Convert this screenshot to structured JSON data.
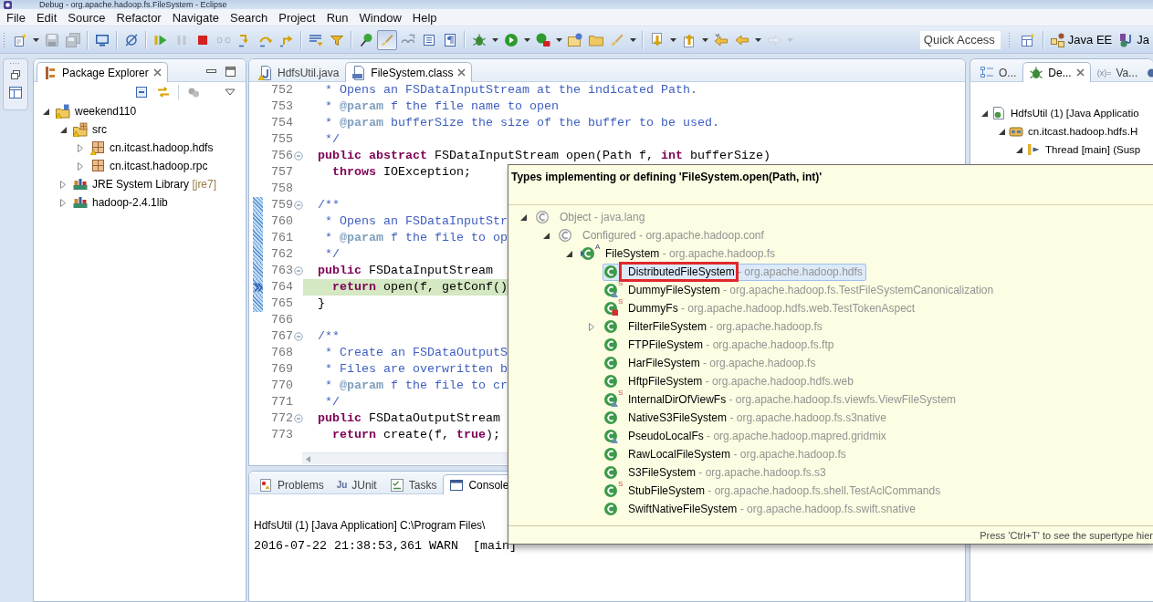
{
  "window": {
    "title": "Debug - org.apache.hadoop.fs.FileSystem - Eclipse"
  },
  "menu": [
    "File",
    "Edit",
    "Source",
    "Refactor",
    "Navigate",
    "Search",
    "Project",
    "Run",
    "Window",
    "Help"
  ],
  "toolbar": {
    "items": [
      {
        "kind": "new",
        "dropdown": true,
        "disabled": false,
        "pressed": false
      },
      {
        "kind": "save",
        "dropdown": false,
        "disabled": true,
        "pressed": false
      },
      {
        "kind": "save-all",
        "dropdown": false,
        "disabled": true,
        "pressed": false
      },
      {
        "kind": "separator"
      },
      {
        "kind": "monitor",
        "dropdown": false,
        "disabled": false,
        "pressed": false
      },
      {
        "kind": "separator"
      },
      {
        "kind": "skip-breakpoints",
        "dropdown": false,
        "disabled": false,
        "pressed": false
      },
      {
        "kind": "separator"
      },
      {
        "kind": "resume",
        "dropdown": false,
        "disabled": false,
        "pressed": false
      },
      {
        "kind": "suspend",
        "dropdown": false,
        "disabled": true,
        "pressed": false
      },
      {
        "kind": "terminate",
        "dropdown": false,
        "disabled": false,
        "pressed": false
      },
      {
        "kind": "disconnect",
        "dropdown": false,
        "disabled": true,
        "pressed": false
      },
      {
        "kind": "step-into",
        "dropdown": false,
        "disabled": false,
        "pressed": false
      },
      {
        "kind": "step-over",
        "dropdown": false,
        "disabled": false,
        "pressed": false
      },
      {
        "kind": "step-return",
        "dropdown": false,
        "disabled": false,
        "pressed": false
      },
      {
        "kind": "separator"
      },
      {
        "kind": "drop-frame",
        "dropdown": false,
        "disabled": false,
        "pressed": false
      },
      {
        "kind": "step-filters",
        "dropdown": false,
        "disabled": false,
        "pressed": false
      },
      {
        "kind": "separator"
      },
      {
        "kind": "breakpoint-pin",
        "dropdown": false,
        "disabled": false,
        "pressed": false
      },
      {
        "kind": "highlight",
        "dropdown": false,
        "disabled": false,
        "pressed": true
      },
      {
        "kind": "show-whitespace",
        "dropdown": false,
        "disabled": false,
        "pressed": false
      },
      {
        "kind": "block-select",
        "dropdown": false,
        "disabled": false,
        "pressed": false
      },
      {
        "kind": "paragraph",
        "dropdown": false,
        "disabled": false,
        "pressed": false
      },
      {
        "kind": "separator"
      },
      {
        "kind": "debug",
        "dropdown": true,
        "disabled": false,
        "pressed": false
      },
      {
        "kind": "run",
        "dropdown": true,
        "disabled": false,
        "pressed": false
      },
      {
        "kind": "external-tools",
        "dropdown": true,
        "disabled": false,
        "pressed": false
      },
      {
        "kind": "new-package",
        "dropdown": false,
        "disabled": false,
        "pressed": false
      },
      {
        "kind": "open-folder",
        "dropdown": false,
        "disabled": false,
        "pressed": false
      },
      {
        "kind": "search-brush",
        "dropdown": true,
        "disabled": false,
        "pressed": false
      },
      {
        "kind": "separator"
      },
      {
        "kind": "next-annotation",
        "dropdown": true,
        "disabled": false,
        "pressed": false
      },
      {
        "kind": "prev-annotation",
        "dropdown": true,
        "disabled": false,
        "pressed": false
      },
      {
        "kind": "last-edit",
        "dropdown": false,
        "disabled": false,
        "pressed": false
      },
      {
        "kind": "back",
        "dropdown": true,
        "disabled": false,
        "pressed": false
      },
      {
        "kind": "forward",
        "dropdown": true,
        "disabled": true,
        "pressed": false
      }
    ],
    "quick_access": {
      "placeholder": "Quick Access"
    },
    "perspectives": [
      {
        "label": "Java EE",
        "kind": "javaee",
        "selected": false
      },
      {
        "label": "Ja",
        "kind": "java",
        "selected": false
      }
    ]
  },
  "package_explorer": {
    "tab": {
      "label": "Package Explorer",
      "selected": true
    },
    "tree": [
      {
        "label": "weekend110",
        "kind": "project",
        "expanded": true,
        "warning": true,
        "selected": false,
        "children": [
          {
            "label": "src",
            "kind": "source-folder",
            "expanded": true,
            "warning": true,
            "selected": false,
            "children": [
              {
                "label": "cn.itcast.hadoop.hdfs",
                "kind": "package",
                "expanded": false,
                "warning": true,
                "selected": false
              },
              {
                "label": "cn.itcast.hadoop.rpc",
                "kind": "package",
                "expanded": false,
                "warning": false,
                "selected": false
              }
            ]
          },
          {
            "label": "JRE System Library",
            "decoration": "[jre7]",
            "kind": "library",
            "expanded": false,
            "warning": false,
            "selected": false
          },
          {
            "label": "hadoop-2.4.1lib",
            "kind": "library",
            "expanded": false,
            "warning": false,
            "selected": false
          }
        ]
      }
    ]
  },
  "editor": {
    "tabs": [
      {
        "label": "HdfsUtil.java",
        "kind": "java",
        "selected": false,
        "warning": true
      },
      {
        "label": "FileSystem.class",
        "kind": "class",
        "selected": true,
        "warning": false
      }
    ],
    "lines": [
      {
        "number": "752",
        "fold": false,
        "in_range": false,
        "current": false,
        "tokens": [
          {
            "kind": "comment",
            "text": " * Opens an FSDataInputStream at the indicated Path."
          }
        ]
      },
      {
        "number": "753",
        "fold": false,
        "in_range": false,
        "current": false,
        "tokens": [
          {
            "kind": "comment",
            "text": " * "
          },
          {
            "kind": "tag",
            "text": "@param"
          },
          {
            "kind": "comment",
            "text": " f the file name to open"
          }
        ]
      },
      {
        "number": "754",
        "fold": false,
        "in_range": false,
        "current": false,
        "tokens": [
          {
            "kind": "comment",
            "text": " * "
          },
          {
            "kind": "tag",
            "text": "@param"
          },
          {
            "kind": "comment",
            "text": " bufferSize the size of the buffer to be used."
          }
        ]
      },
      {
        "number": "755",
        "fold": false,
        "in_range": false,
        "current": false,
        "tokens": [
          {
            "kind": "comment",
            "text": " */"
          }
        ]
      },
      {
        "number": "756",
        "fold": true,
        "in_range": false,
        "current": false,
        "tokens": [
          {
            "kind": "keyword",
            "text": "public abstract"
          },
          {
            "kind": "plain",
            "text": " FSDataInputStream open(Path f, "
          },
          {
            "kind": "keyword",
            "text": "int"
          },
          {
            "kind": "plain",
            "text": " bufferSize)"
          }
        ]
      },
      {
        "number": "757",
        "fold": false,
        "in_range": false,
        "current": false,
        "tokens": [
          {
            "kind": "keyword",
            "text": "  throws"
          },
          {
            "kind": "plain",
            "text": " IOException;"
          }
        ]
      },
      {
        "number": "758",
        "fold": false,
        "in_range": false
      },
      {
        "number": "759",
        "fold": true,
        "in_range": true,
        "current": false,
        "tokens": [
          {
            "kind": "comment",
            "text": "/**"
          }
        ]
      },
      {
        "number": "760",
        "fold": false,
        "in_range": true,
        "current": false,
        "tokens": [
          {
            "kind": "comment",
            "text": " * Opens an FSDataInputStr"
          }
        ]
      },
      {
        "number": "761",
        "fold": false,
        "in_range": true,
        "current": false,
        "tokens": [
          {
            "kind": "comment",
            "text": " * "
          },
          {
            "kind": "tag",
            "text": "@param"
          },
          {
            "kind": "comment",
            "text": " f the file to op"
          }
        ]
      },
      {
        "number": "762",
        "fold": false,
        "in_range": true,
        "current": false,
        "tokens": [
          {
            "kind": "comment",
            "text": " */"
          }
        ]
      },
      {
        "number": "763",
        "fold": true,
        "in_range": true,
        "current": false,
        "tokens": [
          {
            "kind": "keyword",
            "text": "public"
          },
          {
            "kind": "plain",
            "text": " FSDataInputStream"
          }
        ]
      },
      {
        "number": "764",
        "fold": false,
        "in_range": true,
        "current": true,
        "tokens": [
          {
            "kind": "keyword",
            "text": "  return"
          },
          {
            "kind": "plain",
            "text": " open(f, getConf()"
          }
        ]
      },
      {
        "number": "765",
        "fold": false,
        "in_range": true,
        "current": false,
        "tokens": [
          {
            "kind": "plain",
            "text": "}"
          }
        ]
      },
      {
        "number": "766",
        "fold": false,
        "in_range": false
      },
      {
        "number": "767",
        "fold": true,
        "in_range": false,
        "current": false,
        "tokens": [
          {
            "kind": "comment",
            "text": "/**"
          }
        ]
      },
      {
        "number": "768",
        "fold": false,
        "in_range": false,
        "current": false,
        "tokens": [
          {
            "kind": "comment",
            "text": " * Create an FSDataOutputS"
          }
        ]
      },
      {
        "number": "769",
        "fold": false,
        "in_range": false,
        "current": false,
        "tokens": [
          {
            "kind": "comment",
            "text": " * Files are overwritten b"
          }
        ]
      },
      {
        "number": "770",
        "fold": false,
        "in_range": false,
        "current": false,
        "tokens": [
          {
            "kind": "comment",
            "text": " * "
          },
          {
            "kind": "tag",
            "text": "@param"
          },
          {
            "kind": "comment",
            "text": " f the file to cr"
          }
        ]
      },
      {
        "number": "771",
        "fold": false,
        "in_range": false,
        "current": false,
        "tokens": [
          {
            "kind": "comment",
            "text": " */"
          }
        ]
      },
      {
        "number": "772",
        "fold": true,
        "in_range": false,
        "current": false,
        "tokens": [
          {
            "kind": "keyword",
            "text": "public"
          },
          {
            "kind": "plain",
            "text": " FSDataOutputStream"
          }
        ]
      },
      {
        "number": "773",
        "fold": false,
        "in_range": false,
        "current": false,
        "tokens": [
          {
            "kind": "keyword",
            "text": "  return"
          },
          {
            "kind": "plain",
            "text": " create(f, "
          },
          {
            "kind": "keyword",
            "text": "true"
          },
          {
            "kind": "plain",
            "text": ");"
          }
        ]
      }
    ]
  },
  "bottom_panel": {
    "tabs": [
      {
        "label": "Problems",
        "kind": "problems",
        "selected": false
      },
      {
        "label": "JUnit",
        "kind": "junit",
        "glyph": "Ju",
        "selected": false
      },
      {
        "label": "Tasks",
        "kind": "tasks",
        "selected": false
      },
      {
        "label": "Console",
        "kind": "console",
        "selected": true
      }
    ],
    "console": {
      "process": "HdfsUtil (1) [Java Application] C:\\Program Files\\",
      "lines": [
        "2016-07-22 21:38:53,361 WARN  [main]"
      ]
    }
  },
  "debug_view": {
    "tabs": [
      {
        "label": "O...",
        "kind": "outline",
        "selected": false
      },
      {
        "label": "De...",
        "kind": "debug",
        "selected": true
      },
      {
        "label": "Va...",
        "kind": "variables",
        "glyph": "(x)=",
        "selected": false
      },
      {
        "kind": "breakpoints",
        "selected": false
      }
    ],
    "tree": [
      {
        "label": "HdfsUtil (1) [Java Applicatio",
        "kind": "launch",
        "expanded": true,
        "selected": false,
        "children": [
          {
            "label": "cn.itcast.hadoop.hdfs.H",
            "kind": "target",
            "expanded": true,
            "selected": false,
            "children": [
              {
                "label": "Thread [main] (Susp",
                "kind": "thread",
                "expanded": true,
                "selected": false
              }
            ]
          }
        ]
      }
    ]
  },
  "popup": {
    "title": "Types implementing or defining 'FileSystem.open(Path, int)'",
    "tree": [
      {
        "name": "Object",
        "package": "- java.lang",
        "kind": "public",
        "dimmed": true,
        "expanded": true,
        "selected": false,
        "annotated": false,
        "children": [
          {
            "name": "Configured",
            "package": "- org.apache.hadoop.conf",
            "kind": "public",
            "dimmed": true,
            "expanded": true,
            "selected": false,
            "annotated": false,
            "children": [
              {
                "name": "FileSystem",
                "package": "- org.apache.hadoop.fs",
                "kind": "focus",
                "dimmed": false,
                "expanded": true,
                "selected": false,
                "annotated": false,
                "modifier": "A",
                "children": [
                  {
                    "name": "DistributedFileSystem",
                    "package": "- org.apache.hadoop.hdfs",
                    "kind": "public",
                    "dimmed": false,
                    "selected": true,
                    "annotated": true
                  },
                  {
                    "name": "DummyFileSystem",
                    "package": "- org.apache.hadoop.fs.TestFileSystemCanonicalization",
                    "kind": "package",
                    "dimmed": false,
                    "selected": false,
                    "annotated": false,
                    "modifier": "S"
                  },
                  {
                    "name": "DummyFs",
                    "package": "- org.apache.hadoop.hdfs.web.TestTokenAspect",
                    "kind": "private",
                    "dimmed": false,
                    "selected": false,
                    "annotated": false,
                    "modifier": "S"
                  },
                  {
                    "name": "FilterFileSystem",
                    "package": "- org.apache.hadoop.fs",
                    "kind": "public",
                    "dimmed": false,
                    "selected": false,
                    "annotated": false,
                    "expanded": false
                  },
                  {
                    "name": "FTPFileSystem",
                    "package": "- org.apache.hadoop.fs.ftp",
                    "kind": "public",
                    "dimmed": false,
                    "selected": false,
                    "annotated": false
                  },
                  {
                    "name": "HarFileSystem",
                    "package": "- org.apache.hadoop.fs",
                    "kind": "public",
                    "dimmed": false,
                    "selected": false,
                    "annotated": false
                  },
                  {
                    "name": "HftpFileSystem",
                    "package": "- org.apache.hadoop.hdfs.web",
                    "kind": "public",
                    "dimmed": false,
                    "selected": false,
                    "annotated": false
                  },
                  {
                    "name": "InternalDirOfViewFs",
                    "package": "- org.apache.hadoop.fs.viewfs.ViewFileSystem",
                    "kind": "package",
                    "dimmed": false,
                    "selected": false,
                    "annotated": false,
                    "modifier": "S"
                  },
                  {
                    "name": "NativeS3FileSystem",
                    "package": "- org.apache.hadoop.fs.s3native",
                    "kind": "public",
                    "dimmed": false,
                    "selected": false,
                    "annotated": false
                  },
                  {
                    "name": "PseudoLocalFs",
                    "package": "- org.apache.hadoop.mapred.gridmix",
                    "kind": "package",
                    "dimmed": false,
                    "selected": false,
                    "annotated": false
                  },
                  {
                    "name": "RawLocalFileSystem",
                    "package": "- org.apache.hadoop.fs",
                    "kind": "public",
                    "dimmed": false,
                    "selected": false,
                    "annotated": false
                  },
                  {
                    "name": "S3FileSystem",
                    "package": "- org.apache.hadoop.fs.s3",
                    "kind": "public",
                    "dimmed": false,
                    "selected": false,
                    "annotated": false
                  },
                  {
                    "name": "StubFileSystem",
                    "package": "- org.apache.hadoop.fs.shell.TestAclCommands",
                    "kind": "public",
                    "dimmed": false,
                    "selected": false,
                    "annotated": false,
                    "modifier": "S"
                  },
                  {
                    "name": "SwiftNativeFileSystem",
                    "package": "- org.apache.hadoop.fs.swift.snative",
                    "kind": "public",
                    "dimmed": false,
                    "selected": false,
                    "annotated": false
                  }
                ]
              }
            ]
          }
        ]
      }
    ],
    "footer": "Press 'Ctrl+T' to see the supertype hier"
  }
}
